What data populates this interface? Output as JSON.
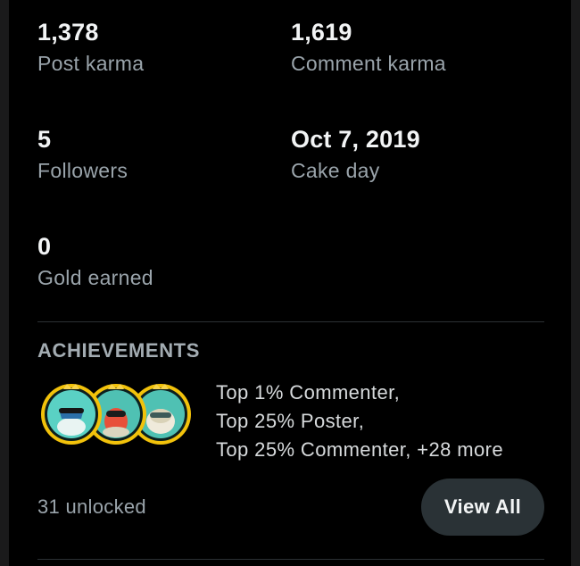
{
  "stats": {
    "post_karma": {
      "value": "1,378",
      "label": "Post karma"
    },
    "comment_karma": {
      "value": "1,619",
      "label": "Comment karma"
    },
    "followers": {
      "value": "5",
      "label": "Followers"
    },
    "cake_day": {
      "value": "Oct 7, 2019",
      "label": "Cake day"
    },
    "gold_earned": {
      "value": "0",
      "label": "Gold earned"
    }
  },
  "achievements": {
    "title": "ACHIEVEMENTS",
    "lines": [
      "Top 1% Commenter,",
      "Top 25% Poster,",
      "Top 25% Commenter, +28 more"
    ],
    "badges": [
      {
        "icon": "commenter-badge-icon",
        "color": "#5ad1c4"
      },
      {
        "icon": "poster-badge-icon",
        "color": "#e8503a"
      },
      {
        "icon": "commenter-badge-icon-2",
        "color": "#e7e2c8"
      }
    ],
    "unlocked_text": "31 unlocked",
    "view_all_label": "View All"
  },
  "colors": {
    "background": "#000000",
    "value_text": "#f2f4f5",
    "label_text": "#9aa4ab",
    "button_bg": "#2a3236",
    "badge_ring": "#f2c20b"
  }
}
